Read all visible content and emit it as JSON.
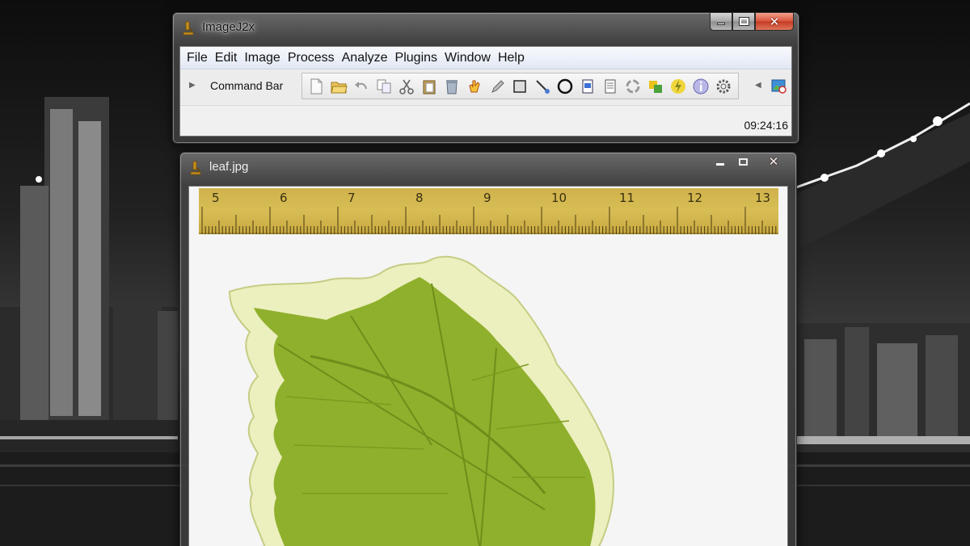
{
  "desktop": {
    "wallpaper": "city-night-skyline"
  },
  "imagej_window": {
    "title": "ImageJ2x",
    "menu": [
      "File",
      "Edit",
      "Image",
      "Process",
      "Analyze",
      "Plugins",
      "Window",
      "Help"
    ],
    "command_bar_label": "Command Bar",
    "tools": [
      "new-file-icon",
      "open-folder-icon",
      "undo-icon",
      "copy-icon",
      "cut-icon",
      "paste-icon",
      "delete-icon",
      "hand-icon",
      "pencil-icon",
      "rectangle-select-icon",
      "line-icon",
      "oval-icon",
      "document-icon",
      "page-icon",
      "recycle-icon",
      "color-picker-icon",
      "lightning-icon",
      "info-icon",
      "settings-icon"
    ],
    "clock": "09:24:16",
    "accent_close": "#d4543b"
  },
  "image_window": {
    "title": "leaf.jpg",
    "ruler_labels": [
      "5",
      "6",
      "7",
      "8",
      "9",
      "10",
      "11",
      "12",
      "13"
    ],
    "ruler_color": "#d2b751",
    "leaf_green": "#8fb02c",
    "leaf_cream": "#ecefbe"
  }
}
